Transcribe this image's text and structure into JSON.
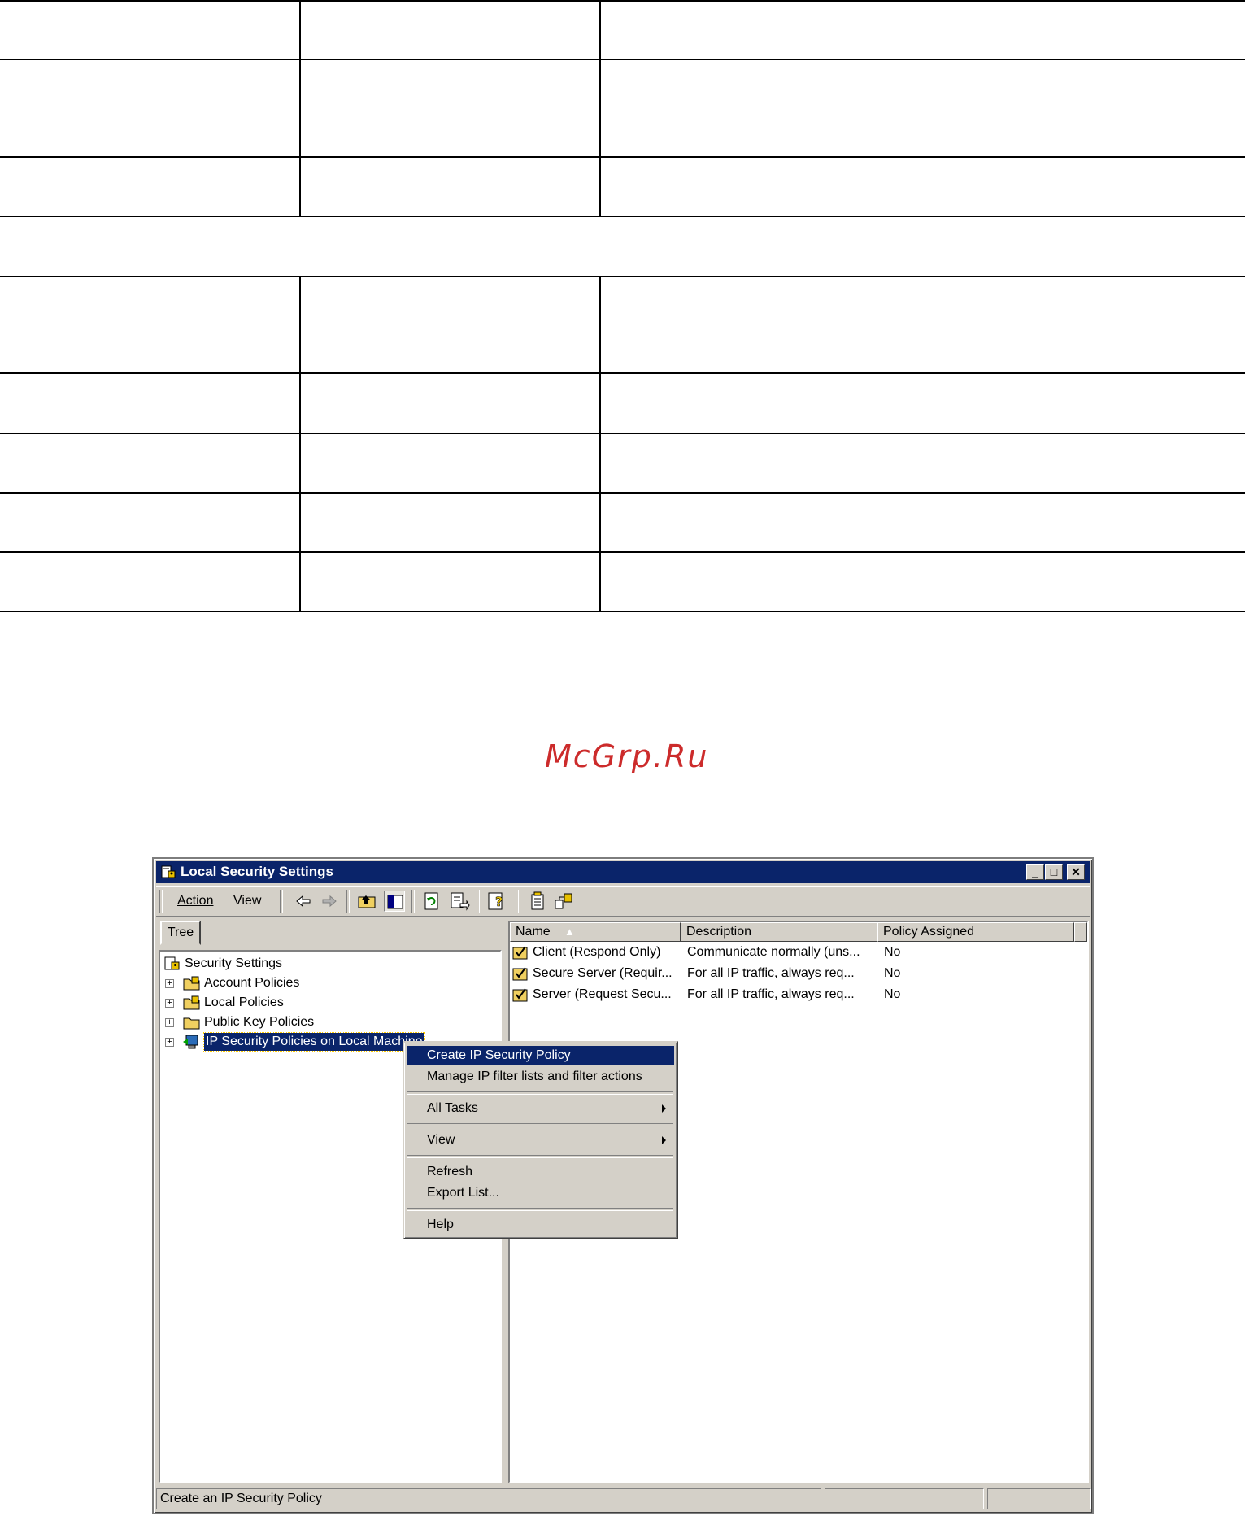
{
  "watermark": "McGrp.Ru",
  "window": {
    "title": "Local Security Settings",
    "minimize": "_",
    "maximize": "□",
    "close": "✕"
  },
  "toolbar": {
    "menus": [
      "Action",
      "View"
    ],
    "tools": [
      "back-icon",
      "forward-icon",
      "up-one-level-icon",
      "show-hide-tree-icon",
      "refresh-icon",
      "export-list-icon",
      "help-icon",
      "create-policy-icon",
      "manage-filters-icon"
    ]
  },
  "tree": {
    "tab_label": "Tree",
    "root": "Security Settings",
    "items": [
      {
        "label": "Account Policies"
      },
      {
        "label": "Local Policies"
      },
      {
        "label": "Public Key Policies"
      },
      {
        "label": "IP Security Policies on Local Machine"
      }
    ]
  },
  "list": {
    "columns": [
      "Name",
      "Description",
      "Policy Assigned"
    ],
    "rows": [
      {
        "name": "Client (Respond Only)",
        "description": "Communicate normally (uns...",
        "assigned": "No"
      },
      {
        "name": "Secure Server (Requir...",
        "description": "For all IP traffic, always req...",
        "assigned": "No"
      },
      {
        "name": "Server (Request Secu...",
        "description": "For all IP traffic, always req...",
        "assigned": "No"
      }
    ]
  },
  "context_menu": {
    "create": "Create IP Security Policy",
    "manage": "Manage IP filter lists and filter actions",
    "all_tasks": "All Tasks",
    "view": "View",
    "refresh": "Refresh",
    "export": "Export List...",
    "help": "Help"
  },
  "status": {
    "text": "Create an IP Security Policy",
    "cell2": "",
    "cell3": ""
  },
  "colors": {
    "titlebar": "#0a246a",
    "chrome": "#d4d0c8",
    "watermark": "#cc2b2b",
    "selection": "#0a246a"
  }
}
